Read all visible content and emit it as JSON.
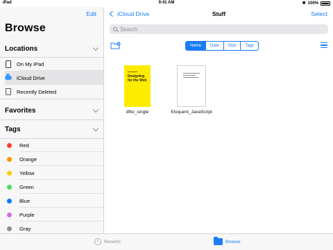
{
  "status": {
    "carrier": "iPad",
    "time": "9:41 AM",
    "battery": "100%"
  },
  "sidebar": {
    "edit_label": "Edit",
    "title": "Browse",
    "locations": {
      "heading": "Locations",
      "items": [
        {
          "label": "On My iPad",
          "icon": "ipad-icon"
        },
        {
          "label": "iCloud Drive",
          "icon": "icloud-icon"
        },
        {
          "label": "Recently Deleted",
          "icon": "trash-icon"
        }
      ]
    },
    "favorites": {
      "heading": "Favorites"
    },
    "tags": {
      "heading": "Tags",
      "items": [
        {
          "label": "Red",
          "color": "#ff3b30"
        },
        {
          "label": "Orange",
          "color": "#ff9500"
        },
        {
          "label": "Yellow",
          "color": "#ffcc00"
        },
        {
          "label": "Green",
          "color": "#4cd964"
        },
        {
          "label": "Blue",
          "color": "#007aff"
        },
        {
          "label": "Purple",
          "color": "#cc73e1"
        },
        {
          "label": "Gray",
          "color": "#8e8e93"
        }
      ]
    }
  },
  "main": {
    "back_label": "iCloud Drive",
    "title": "Stuff",
    "select_label": "Select",
    "search_placeholder": "Search",
    "sort": {
      "options": [
        "Name",
        "Date",
        "Size",
        "Tags"
      ],
      "selected": "Name"
    },
    "files": [
      {
        "name": "dftw_single",
        "cover_title": "Designing for the Web",
        "thumb": "yellow-book-cover"
      },
      {
        "name": "Eloquent_JavaScript",
        "thumb": "white-document"
      }
    ]
  },
  "tabbar": {
    "recents_label": "Recents",
    "browse_label": "Browse"
  },
  "colors": {
    "accent": "#1a7cf6"
  }
}
